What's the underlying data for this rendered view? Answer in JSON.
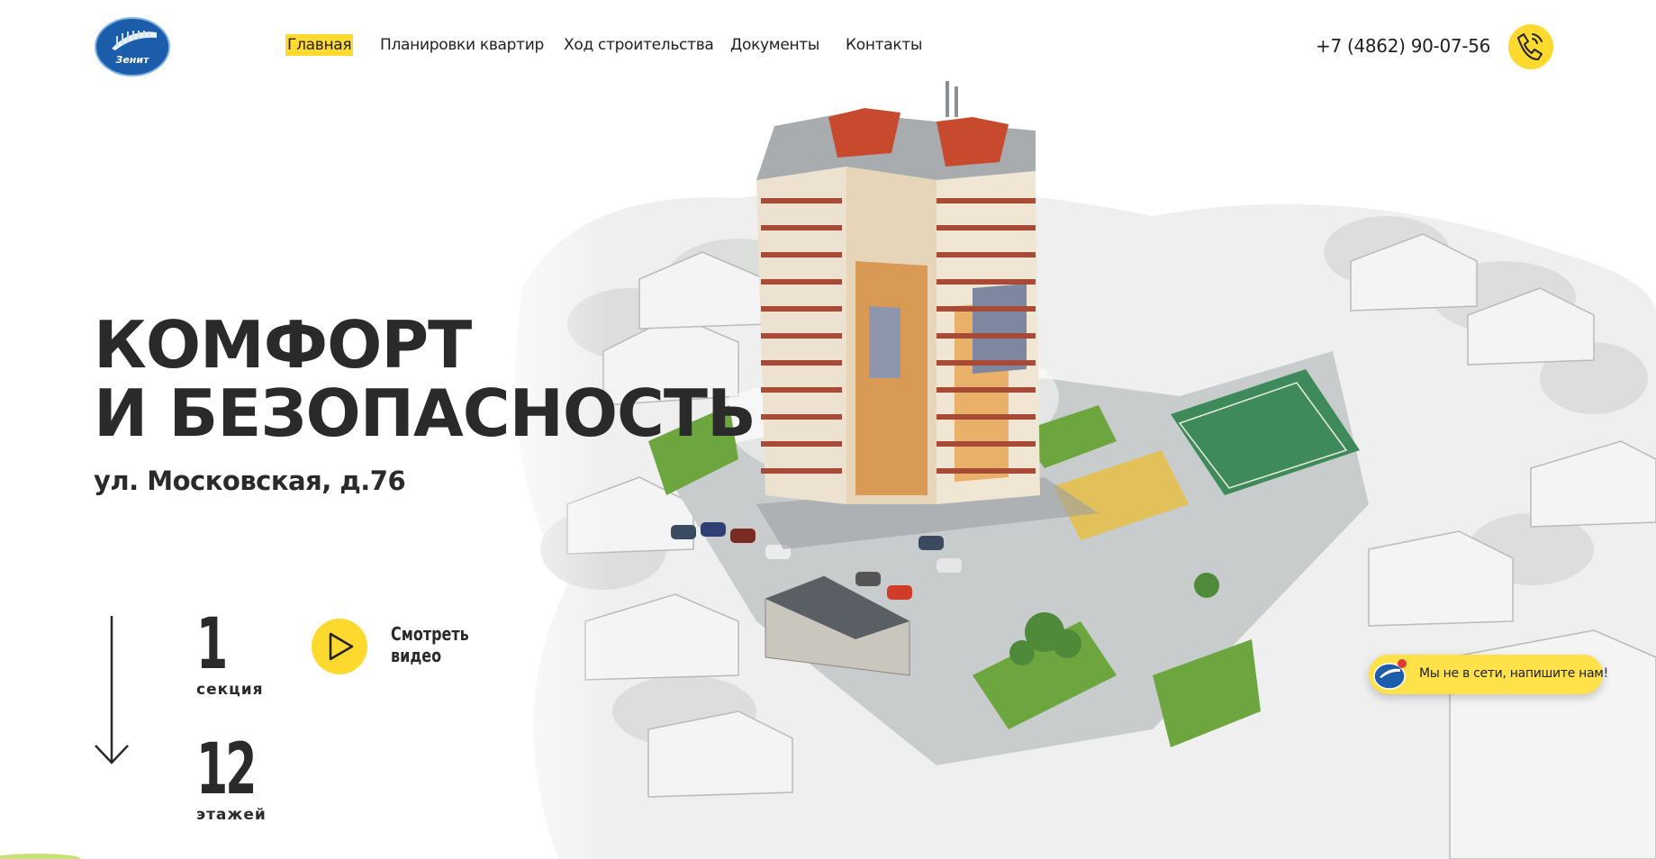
{
  "brand": {
    "logo_text": "Зенит",
    "accent": "#ffd92e",
    "logo_blue": "#1c5dab"
  },
  "nav": {
    "items": [
      {
        "label": "Главная",
        "active": true
      },
      {
        "label": "Планировки квартир",
        "active": false
      },
      {
        "label": "Ход строительства",
        "active": false
      },
      {
        "label": "Документы",
        "active": false
      },
      {
        "label": "Контакты",
        "active": false
      }
    ]
  },
  "header": {
    "phone": "+7 (4862) 90-07-56",
    "call_icon": "phone-icon"
  },
  "hero": {
    "title_line1": "КОМФОРТ",
    "title_line2": "И БЕЗОПАСНОСТЬ",
    "address": "ул. Московская, д.76",
    "scroll_icon": "arrow-down-icon",
    "stats": [
      {
        "value": "1",
        "label": "секция"
      },
      {
        "value": "12",
        "label": "этажей"
      }
    ],
    "video": {
      "line1": "Смотреть",
      "line2": "видео",
      "icon": "play-icon"
    }
  },
  "chat": {
    "text": "Мы не в сети, напишите нам!",
    "icon": "chat-logo-icon"
  }
}
